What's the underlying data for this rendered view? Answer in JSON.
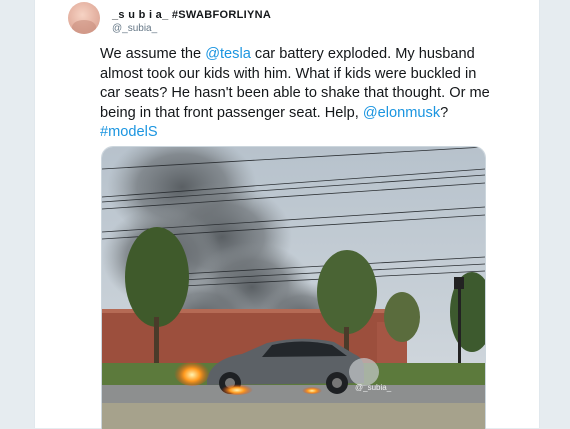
{
  "tweet": {
    "display_name": "_s u b i a_ #SWABFORLIYNA",
    "handle": "@_subia_",
    "text_parts": {
      "t1": "We assume the ",
      "mention_tesla": "@tesla",
      "t2": " car battery exploded. My husband almost took our kids with him. What if kids were buckled in car seats? He hasn't been able to shake that thought. Or me being in that front passenger seat. Help, ",
      "mention_elonmusk": "@elonmusk",
      "t3": "?",
      "hashtag": "#modelS"
    },
    "media": {
      "watermark": "@_subia_",
      "icons": {
        "photo": "burning-car-photo"
      }
    }
  },
  "colors": {
    "link": "#1b95e0",
    "text": "#14171a",
    "secondary": "#657786",
    "background": "#e6ecf0"
  }
}
